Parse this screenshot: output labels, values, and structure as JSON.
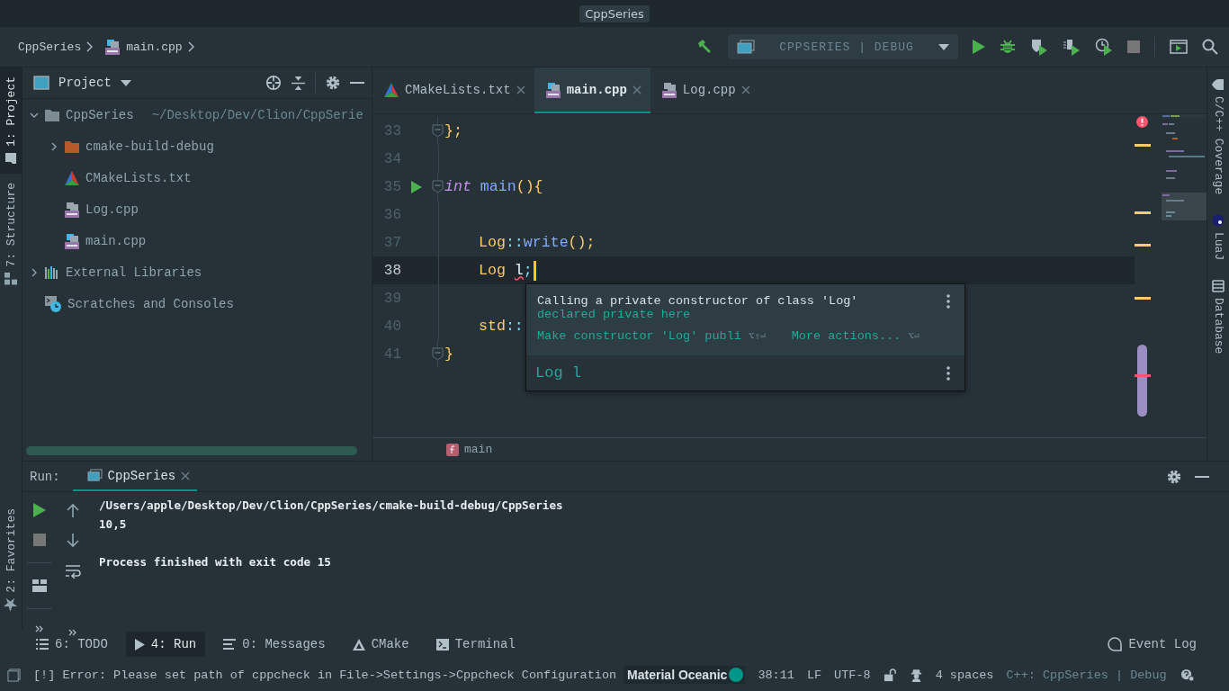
{
  "window": {
    "title": "CppSeries"
  },
  "breadcrumbs": [
    {
      "label": "CppSeries",
      "kind": "plain"
    },
    {
      "label": "main.cpp",
      "kind": "cpp"
    }
  ],
  "toolbar": {
    "run_config": "CPPSERIES | DEBUG"
  },
  "left_stripe": [
    {
      "label": "1: Project",
      "kind": "project",
      "selected": true
    },
    {
      "label": "7: Structure",
      "kind": "structure",
      "selected": false
    }
  ],
  "favorites": "2: Favorites",
  "project_panel": {
    "title": "Project",
    "tree": [
      {
        "label": "CppSeries",
        "hint": "~/Desktop/Dev/Clion/CppSerie",
        "kind": "folder",
        "expanded": true,
        "children": [
          {
            "label": "cmake-build-debug",
            "kind": "build_folder",
            "expanded": false
          },
          {
            "label": "CMakeLists.txt",
            "kind": "cmake"
          },
          {
            "label": "Log.cpp",
            "kind": "cpp"
          },
          {
            "label": "main.cpp",
            "kind": "cpp_main"
          }
        ]
      },
      {
        "label": "External Libraries",
        "kind": "libraries",
        "expanded": false
      },
      {
        "label": "Scratches and Consoles",
        "kind": "scratches"
      }
    ]
  },
  "editor": {
    "tabs": [
      {
        "label": "CMakeLists.txt",
        "kind": "cmake",
        "selected": false
      },
      {
        "label": "main.cpp",
        "kind": "cpp_main",
        "selected": true
      },
      {
        "label": "Log.cpp",
        "kind": "cpp",
        "selected": false
      }
    ],
    "lines": [
      {
        "number": "33",
        "indent": false,
        "current": false,
        "run_marker": false,
        "fold": true,
        "tokens": [
          {
            "kind": "punct",
            "text": "};"
          }
        ]
      },
      {
        "number": "34",
        "current": false,
        "run_marker": false,
        "fold": false
      },
      {
        "number": "35",
        "indent": false,
        "current": false,
        "run_marker": true,
        "fold": true,
        "tokens": [
          {
            "kind": "keyword",
            "text": "int"
          },
          {
            "kind": "func",
            "text": "main"
          },
          {
            "kind": "punct",
            "text": "(){"
          }
        ]
      },
      {
        "number": "36",
        "current": false,
        "run_marker": false,
        "fold": false
      },
      {
        "number": "37",
        "indent": true,
        "current": false,
        "run_marker": false,
        "fold": false,
        "tokens": [
          {
            "kind": "class",
            "text": "Log"
          },
          {
            "kind": "op",
            "text": "::"
          },
          {
            "kind": "func",
            "text": "write"
          },
          {
            "kind": "punct",
            "text": "();"
          }
        ]
      },
      {
        "number": "38",
        "indent": true,
        "current": true,
        "run_marker": false,
        "fold": false,
        "tokens": [
          {
            "kind": "class",
            "text": "Log"
          },
          {
            "kind": "error",
            "text": "l"
          },
          {
            "kind": "op",
            "text": ";"
          }
        ]
      },
      {
        "number": "39",
        "current": false,
        "run_marker": false,
        "fold": false
      },
      {
        "number": "40",
        "indent": true,
        "current": false,
        "run_marker": false,
        "fold": false,
        "tokens": [
          {
            "kind": "class",
            "text": "std"
          },
          {
            "kind": "op",
            "text": "::"
          }
        ]
      },
      {
        "number": "41",
        "indent": false,
        "current": false,
        "run_marker": false,
        "fold": true,
        "tokens": [
          {
            "kind": "punct",
            "text": "}"
          }
        ]
      }
    ],
    "breadcrumb": "main"
  },
  "popup": {
    "message": "Calling a private constructor of class 'Log'",
    "link": "declared private here",
    "actions": [
      {
        "label": "Make constructor 'Log' publi",
        "shortcut": "⌥⇧⏎"
      },
      {
        "label": "More actions...",
        "shortcut": "⌥⏎"
      }
    ],
    "preview": "Log l"
  },
  "right_stripe": [
    {
      "label": "C/C++ Coverage",
      "kind": "coverage"
    },
    {
      "label": "LuaJ",
      "kind": "lua"
    },
    {
      "label": "Database",
      "kind": "database"
    }
  ],
  "run_panel": {
    "label": "Run:",
    "tabs": [
      {
        "label": "CppSeries",
        "selected": true
      }
    ],
    "output": [
      {
        "text": "/Users/apple/Desktop/Dev/Clion/CppSeries/cmake-build-debug/CppSeries",
        "spaced": false
      },
      {
        "text": "10,5",
        "spaced": false
      },
      {
        "text": "Process finished with exit code 15",
        "spaced": true
      }
    ]
  },
  "tool_windows": [
    {
      "label": "6: TODO",
      "kind": "todo",
      "selected": false
    },
    {
      "label": "4: Run",
      "kind": "run",
      "selected": true
    },
    {
      "label": "0: Messages",
      "kind": "messages",
      "selected": false
    },
    {
      "label": "CMake",
      "kind": "cmake",
      "selected": false
    },
    {
      "label": "Terminal",
      "kind": "terminal",
      "selected": false
    }
  ],
  "event_log": "Event Log",
  "status_bar": {
    "message": "[!] Error: Please set path of cppcheck in File->Settings->Cppcheck Configuration",
    "theme": "Material Oceanic",
    "position": "38:11",
    "line_separator": "LF",
    "encoding": "UTF-8",
    "indent": "4 spaces",
    "context": "C++: CppSeries | Debug"
  }
}
